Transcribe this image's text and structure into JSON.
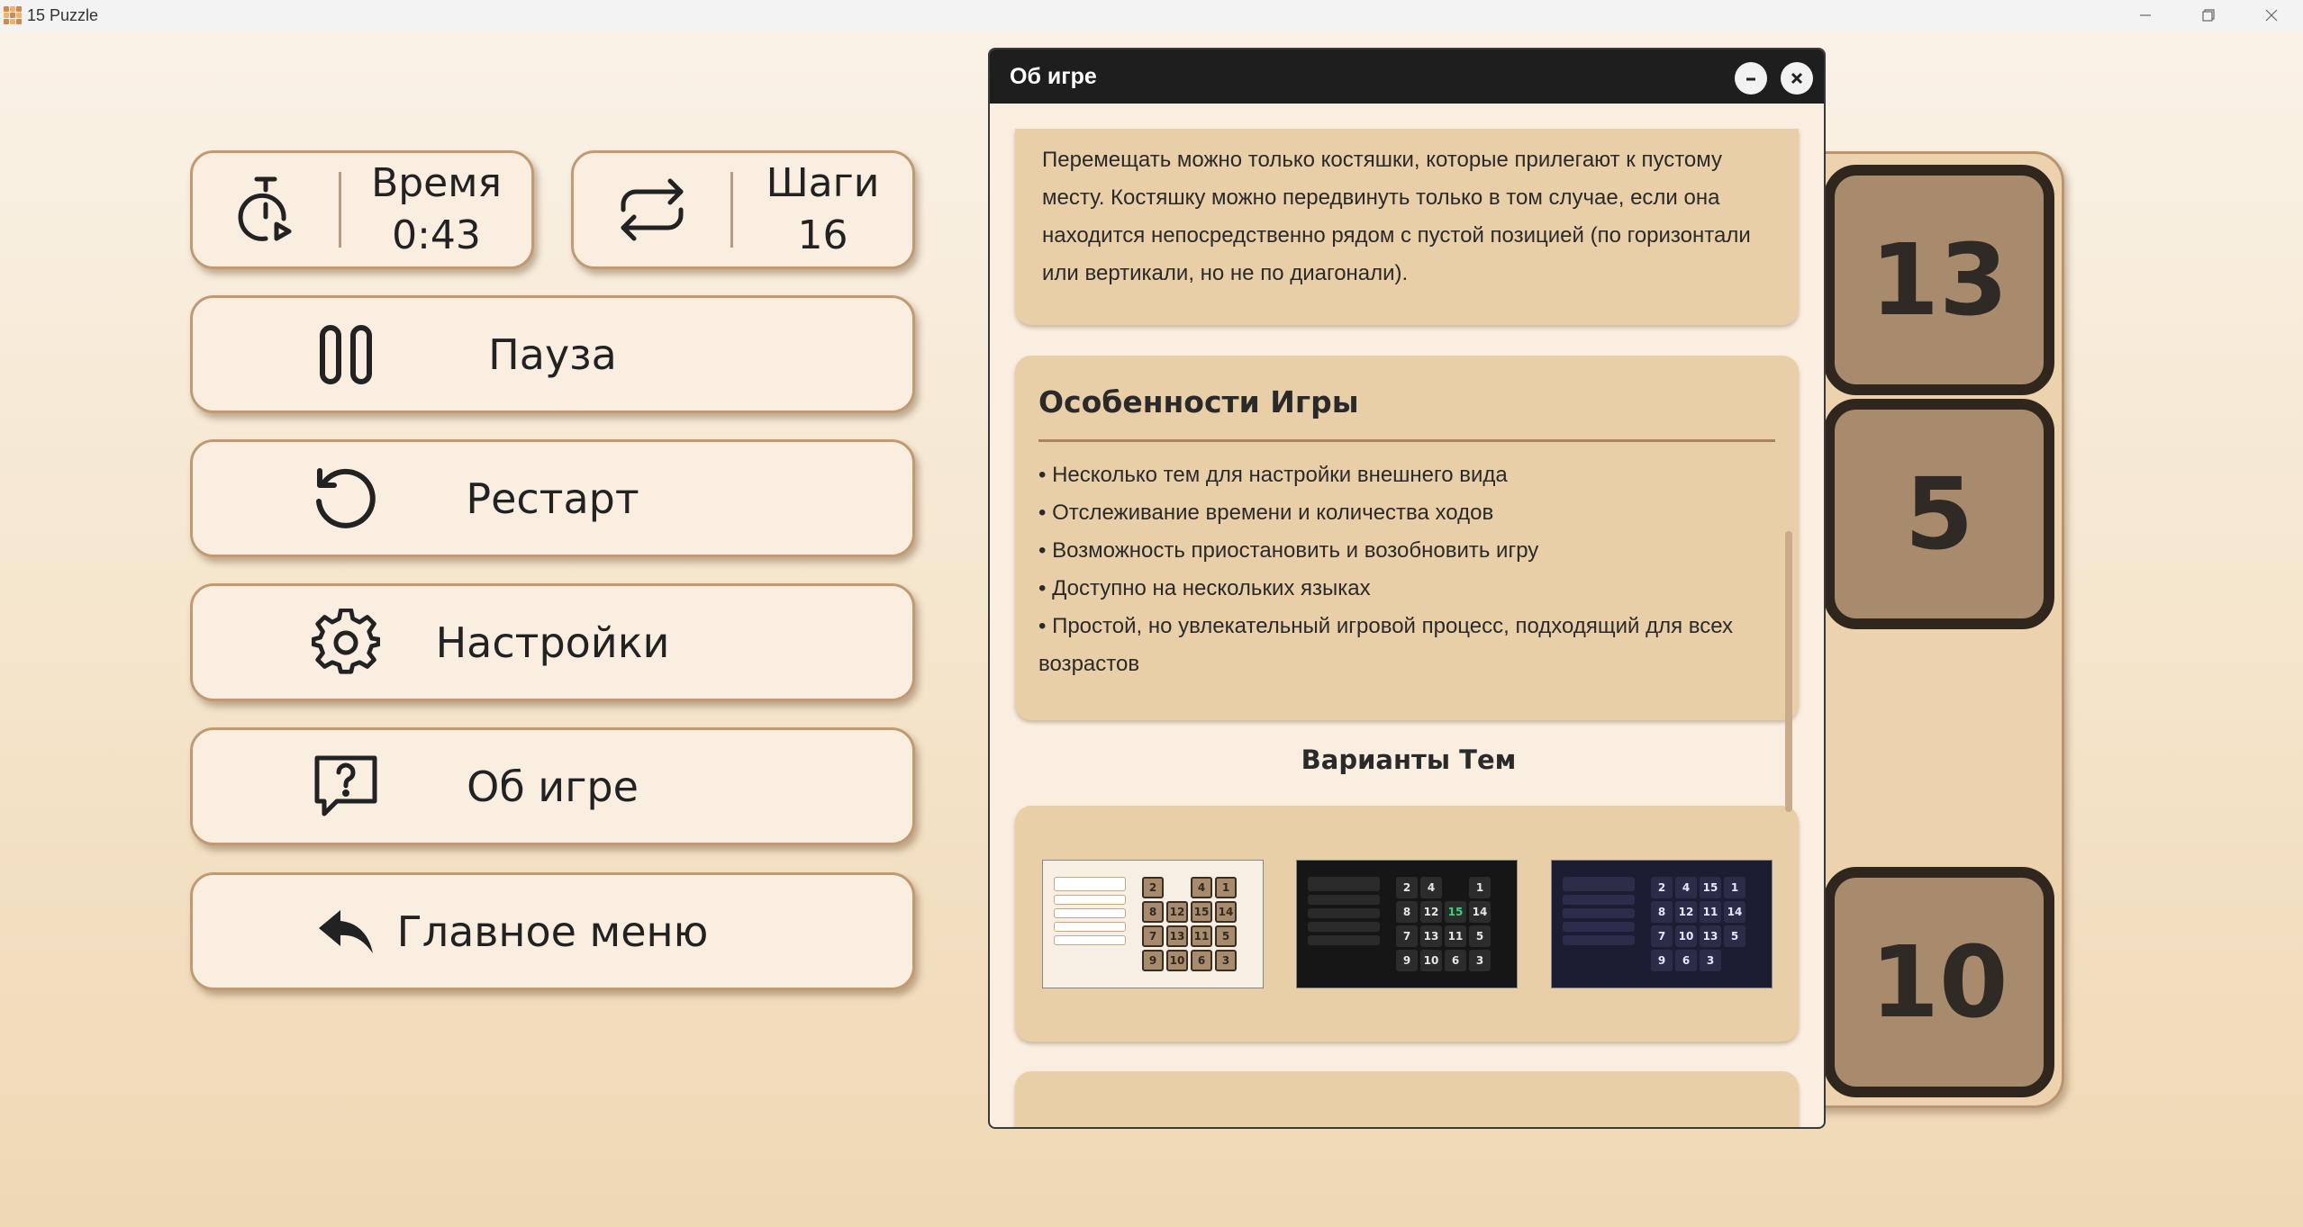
{
  "window": {
    "title": "15 Puzzle"
  },
  "stats": {
    "time_label": "Время",
    "time_value": "0:43",
    "steps_label": "Шаги",
    "steps_value": "16"
  },
  "menu": {
    "pause": "Пауза",
    "restart": "Рестарт",
    "settings": "Настройки",
    "about": "Об игре",
    "main_menu": "Главное меню"
  },
  "board": {
    "tiles": [
      "13",
      "5",
      "10"
    ]
  },
  "dialog": {
    "title": "Об игре",
    "rules_text": "Перемещать можно только костяшки, которые прилегают к пустому месту. Костяшку можно передвинуть только в том случае, если она находится непосредственно рядом с пустой позицией (по горизонтали или вертикали, но не по диагонали).",
    "features_title": "Особенности Игры",
    "features": [
      "• Несколько тем для настройки внешнего вида",
      "• Отслеживание времени и количества ходов",
      "• Возможность приостановить и возобновить игру",
      "• Доступно на нескольких языках",
      "• Простой, но увлекательный игровой процесс, подходящий для всех возрастов"
    ],
    "themes_title": "Варианты Тем",
    "theme_grids": [
      [
        "2",
        "",
        "4",
        "1",
        "8",
        "12",
        "15",
        "14",
        "7",
        "13",
        "11",
        "5",
        "9",
        "10",
        "6",
        "3"
      ],
      [
        "2",
        "4",
        "",
        "1",
        "8",
        "12",
        "15",
        "14",
        "7",
        "13",
        "11",
        "5",
        "9",
        "10",
        "6",
        "3"
      ],
      [
        "2",
        "4",
        "15",
        "1",
        "8",
        "12",
        "11",
        "14",
        "7",
        "10",
        "13",
        "5",
        "9",
        "6",
        "3",
        ""
      ]
    ]
  },
  "colors": {
    "accent": "#c19a73",
    "tile": "#a88b6c",
    "tile_border": "#2f261e",
    "dialog_header": "#1e1e1e",
    "section_bg": "#e9cfa8"
  },
  "icons": {
    "timer": "stopwatch-play-icon",
    "steps": "repeat-arrows-icon",
    "pause": "pause-icon",
    "restart": "restart-icon",
    "settings": "gear-icon",
    "about": "question-bubble-icon",
    "main_menu": "reply-arrow-icon"
  }
}
